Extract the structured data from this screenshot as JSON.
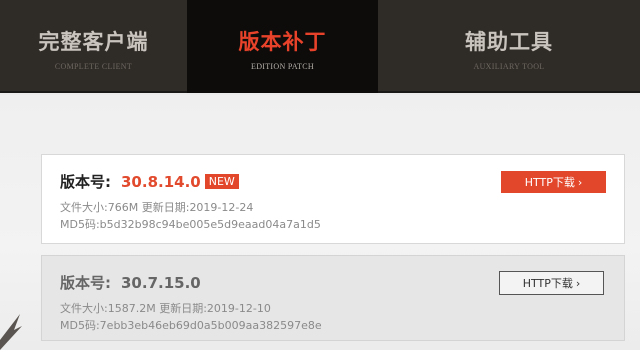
{
  "tabs": [
    {
      "title": "完整客户端",
      "subtitle": "COMPLETE CLIENT"
    },
    {
      "title": "版本补丁",
      "subtitle": "EDITION PATCH"
    },
    {
      "title": "辅助工具",
      "subtitle": "AUXILIARY TOOL"
    }
  ],
  "active_tab": 1,
  "accent_color": "#e2472b",
  "patches": [
    {
      "version_label": "版本号:",
      "version": "30.8.14.0",
      "badge": "NEW",
      "size_label": "文件大小:",
      "size": "766M",
      "date_label": "更新日期:",
      "date": "2019-12-24",
      "md5_label": "MD5码:",
      "md5": "b5d32b98c94be005e5d9eaad04a7a1d5",
      "download_label": "HTTP下载",
      "download_arrow": "›"
    },
    {
      "version_label": "版本号:",
      "version": "30.7.15.0",
      "size_label": "文件大小:",
      "size": "1587.2M",
      "date_label": "更新日期:",
      "date": "2019-12-10",
      "md5_label": "MD5码:",
      "md5": "7ebb3eb46eb69d0a5b009aa382597e8e",
      "download_label": "HTTP下载",
      "download_arrow": "›"
    }
  ]
}
